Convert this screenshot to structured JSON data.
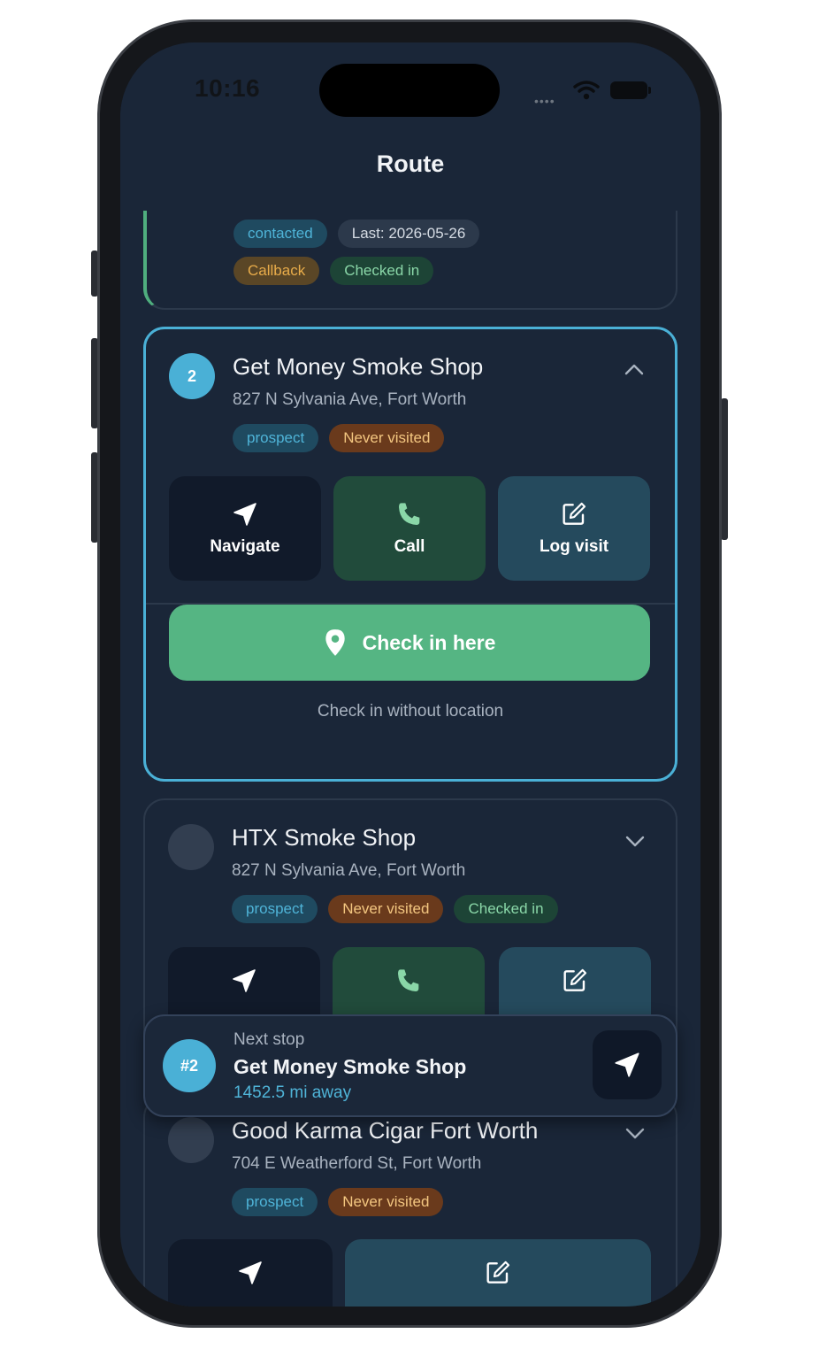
{
  "status": {
    "time": "10:16",
    "signal_dots": "••••"
  },
  "header": {
    "title": "Route"
  },
  "cards": [
    {
      "badges": [
        {
          "label": "contacted"
        },
        {
          "label": "Last: 2026-05-26"
        },
        {
          "label": "Callback"
        },
        {
          "label": "Checked in"
        }
      ]
    },
    {
      "number": "2",
      "name": "Get Money Smoke Shop",
      "address": "827 N Sylvania Ave, Fort Worth",
      "badges": [
        {
          "label": "prospect"
        },
        {
          "label": "Never visited"
        }
      ],
      "actions": {
        "navigate": "Navigate",
        "call": "Call",
        "log": "Log visit"
      },
      "checkin_label": "Check in here",
      "checkin_link": "Check in without location",
      "expanded": true
    },
    {
      "name": "HTX Smoke Shop",
      "address": "827 N Sylvania Ave, Fort Worth",
      "badges": [
        {
          "label": "prospect"
        },
        {
          "label": "Never visited"
        },
        {
          "label": "Checked in"
        }
      ]
    },
    {
      "name": "Good Karma Cigar Fort Worth",
      "address": "704 E Weatherford St, Fort Worth",
      "badges": [
        {
          "label": "prospect"
        },
        {
          "label": "Never visited"
        }
      ]
    }
  ],
  "next_stop": {
    "number": "#2",
    "label": "Next stop",
    "name": "Get Money Smoke Shop",
    "distance": "1452.5 mi away"
  },
  "colors": {
    "background": "#1a2638",
    "accent": "#4ab0d6",
    "checkin_green": "#55b583",
    "border": "#2c394b"
  },
  "icons": [
    "navigation-arrow-icon",
    "phone-icon",
    "edit-icon",
    "map-pin-icon",
    "chevron-up-icon",
    "chevron-down-icon",
    "wifi-icon",
    "battery-icon"
  ]
}
